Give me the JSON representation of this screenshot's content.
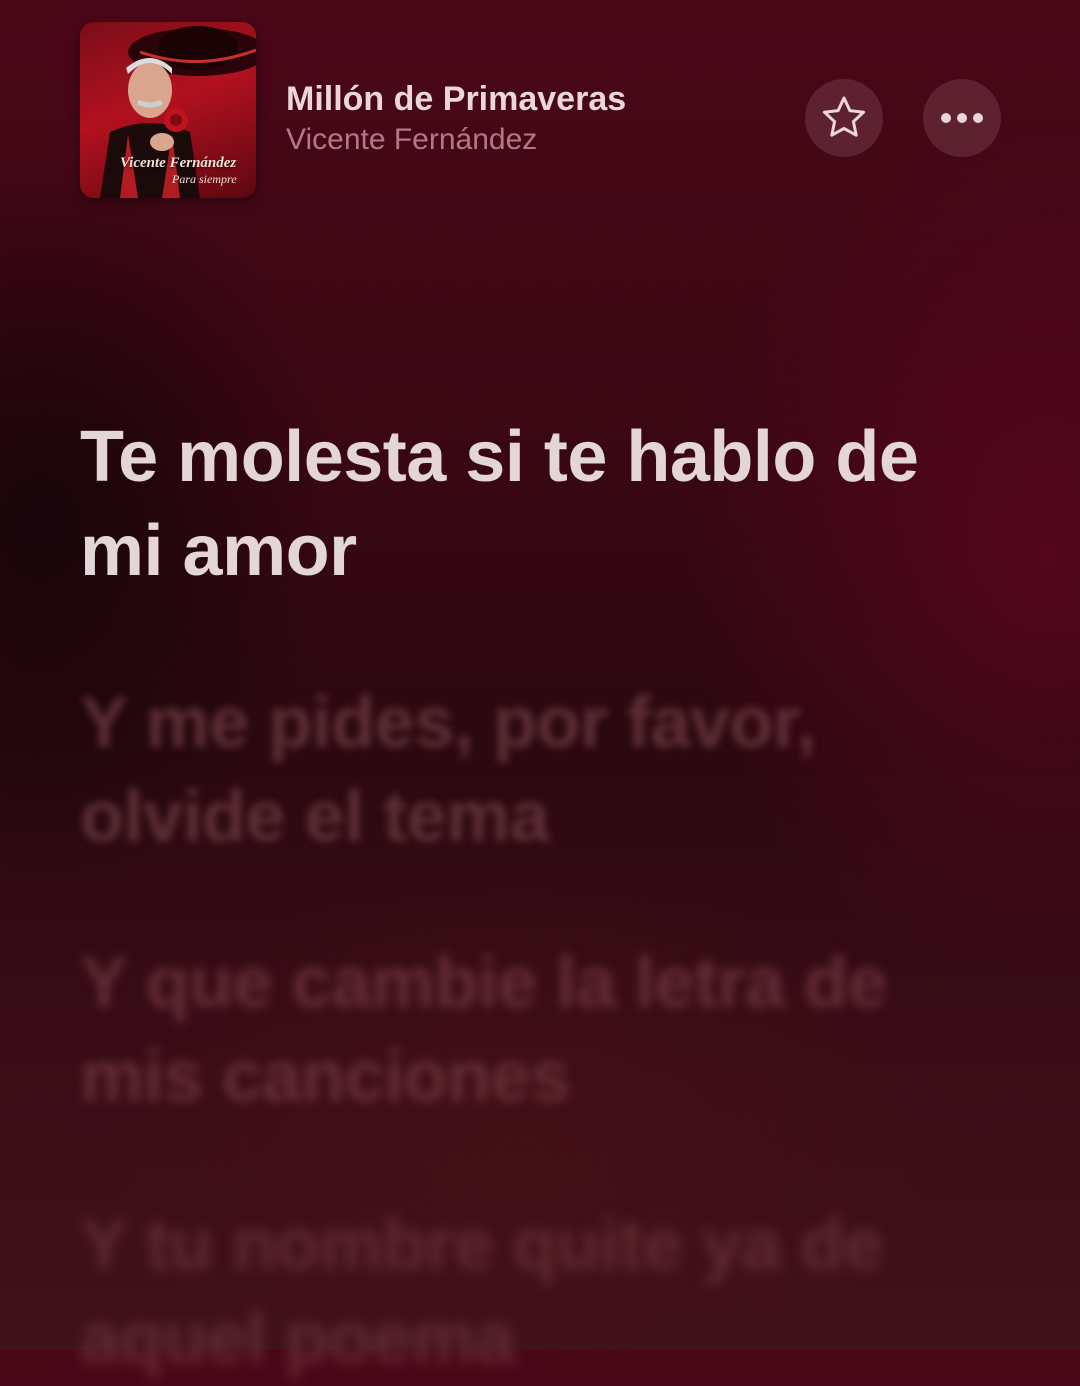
{
  "now_playing": {
    "title": "Millón de Primaveras",
    "artist": "Vicente Fernández",
    "album_art": {
      "artist_text": "Vicente Fernández",
      "subtitle_text": "Para siempre"
    }
  },
  "actions": {
    "favorite_icon": "star-icon",
    "more_icon": "ellipsis-icon"
  },
  "lyrics": {
    "lines": [
      "Te molesta si te hablo de mi amor",
      "Y me pides, por favor, olvide el tema",
      "Y que cambie la letra de mis canciones",
      "Y tu nombre quite ya de aquel poema"
    ],
    "active_index": 0
  },
  "colors": {
    "background": "#3b0713",
    "active_lyric": "#e4d5d8",
    "title_text": "#ead6dc",
    "artist_text": "#b37886"
  }
}
